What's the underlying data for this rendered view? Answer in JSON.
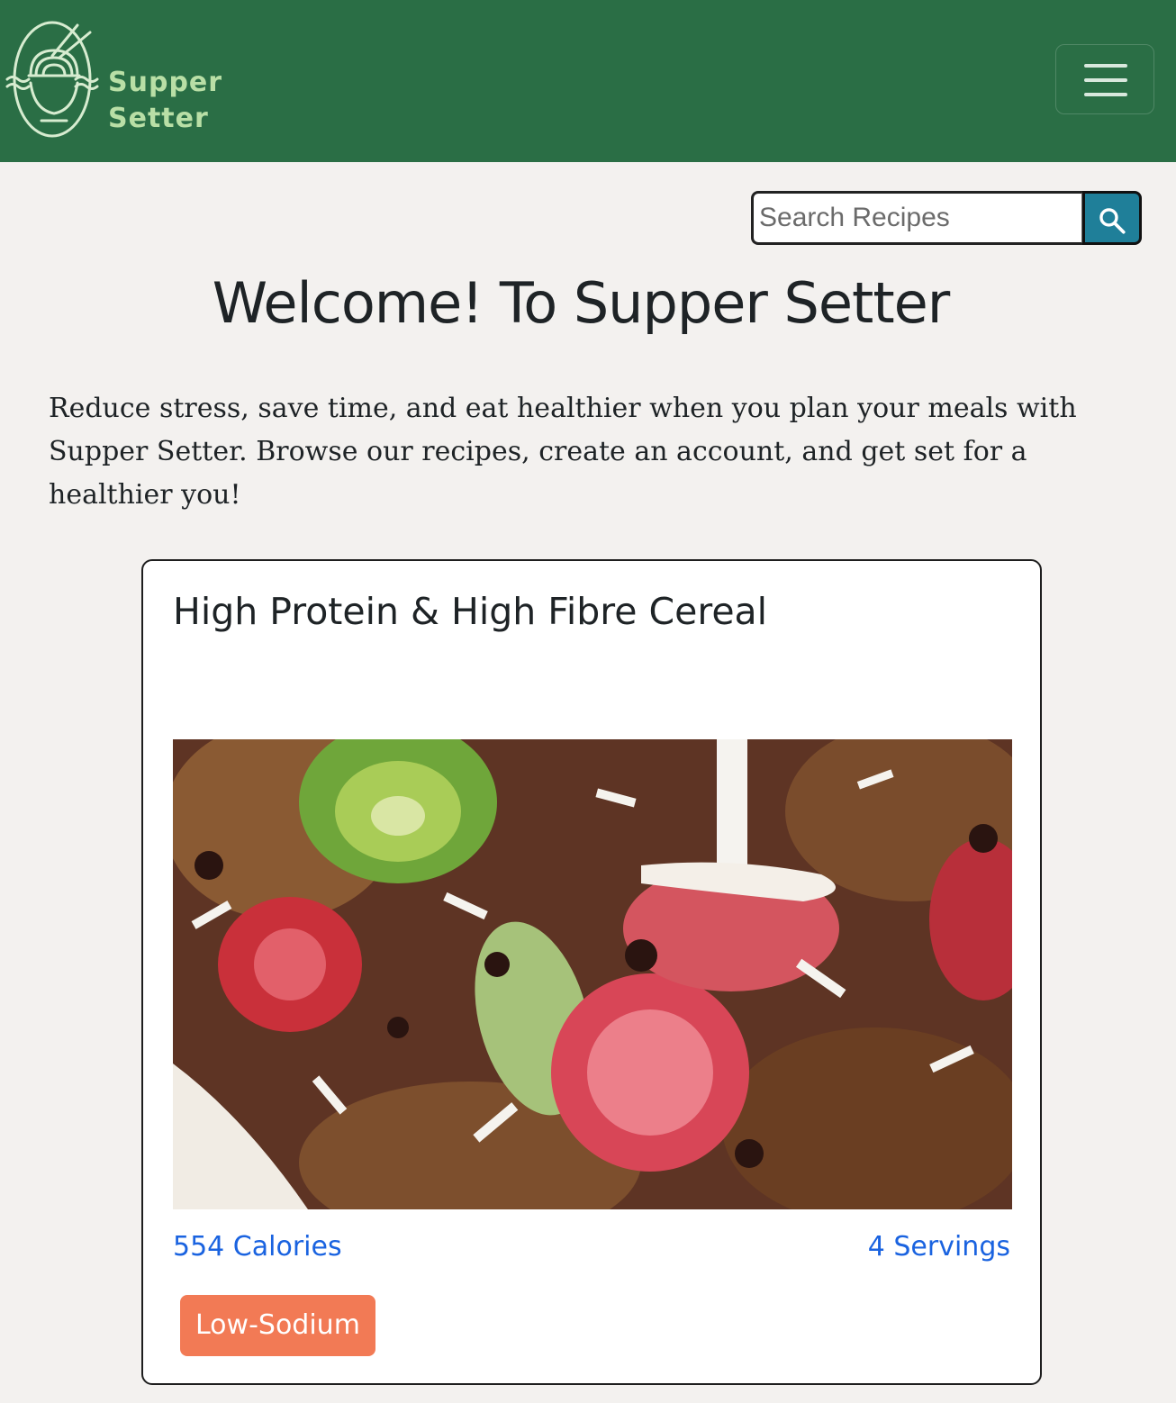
{
  "brand": {
    "line1": "Supper",
    "line2": "Setter",
    "accent": "#b9dfa6",
    "icon": "noodle-bowl-logo-icon"
  },
  "navbar": {
    "background": "#2a6e45",
    "toggler_icon": "hamburger-menu-icon"
  },
  "search": {
    "placeholder": "Search Recipes",
    "value": "",
    "button_icon": "search-icon",
    "button_color": "#1f7f99"
  },
  "main": {
    "title": "Welcome! To Supper Setter",
    "intro": "Reduce stress, save time, and eat healthier when you plan your meals with Supper Setter. Browse our recipes, create an account, and get set for a healthier you!"
  },
  "recipe_card": {
    "title": "High Protein & High Fibre Cereal",
    "calories": "554 Calories",
    "servings": "4 Servings",
    "tags": [
      "Low-Sodium"
    ],
    "tag_color": "#f27a55",
    "link_color": "#1a63e0"
  }
}
